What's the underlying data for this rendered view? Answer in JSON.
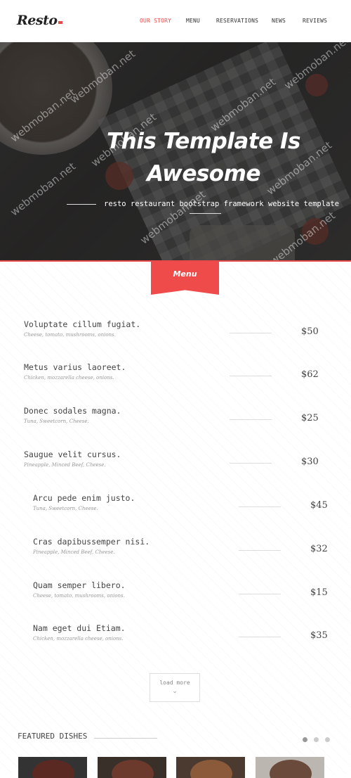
{
  "header": {
    "logo": "Resto",
    "nav": [
      "OUR STORY",
      "MENU",
      "RESERVATIONS",
      "NEWS",
      "REVIEWS"
    ],
    "active_nav": "OUR STORY",
    "accent_color": "#e84a4a"
  },
  "hero": {
    "title_line1": "This Template Is",
    "title_line2": "Awesome",
    "subtitle": "resto restaurant bootstrap framework website template",
    "watermark": "webmoban.net"
  },
  "menu": {
    "ribbon_label": "Menu",
    "items": [
      {
        "name": "Voluptate cillum fugiat.",
        "desc": "Cheese, tomato, mushrooms, onions.",
        "price": "$50"
      },
      {
        "name": "Metus varius laoreet.",
        "desc": "Chicken, mozzarella cheese, onions.",
        "price": "$62"
      },
      {
        "name": "Donec sodales magna.",
        "desc": "Tuna, Sweetcorn, Cheese.",
        "price": "$25"
      },
      {
        "name": "Saugue velit cursus.",
        "desc": "Pineapple, Minced Beef, Cheese.",
        "price": "$30"
      },
      {
        "name": "Arcu pede enim justo.",
        "desc": "Tuna, Sweetcorn, Cheese.",
        "price": "$45"
      },
      {
        "name": "Cras dapibussemper nisi.",
        "desc": "Pineapple, Minced Beef, Cheese.",
        "price": "$32"
      },
      {
        "name": "Quam semper libero.",
        "desc": "Cheese, tomato, mushrooms, onions.",
        "price": "$15"
      },
      {
        "name": "Nam eget dui Etiam.",
        "desc": "Chicken, mozzarella cheese, onions.",
        "price": "$35"
      }
    ],
    "load_more": "load more"
  },
  "featured": {
    "title": "FEATURED DISHES",
    "carousel_pages": 3,
    "active_page": 1
  }
}
